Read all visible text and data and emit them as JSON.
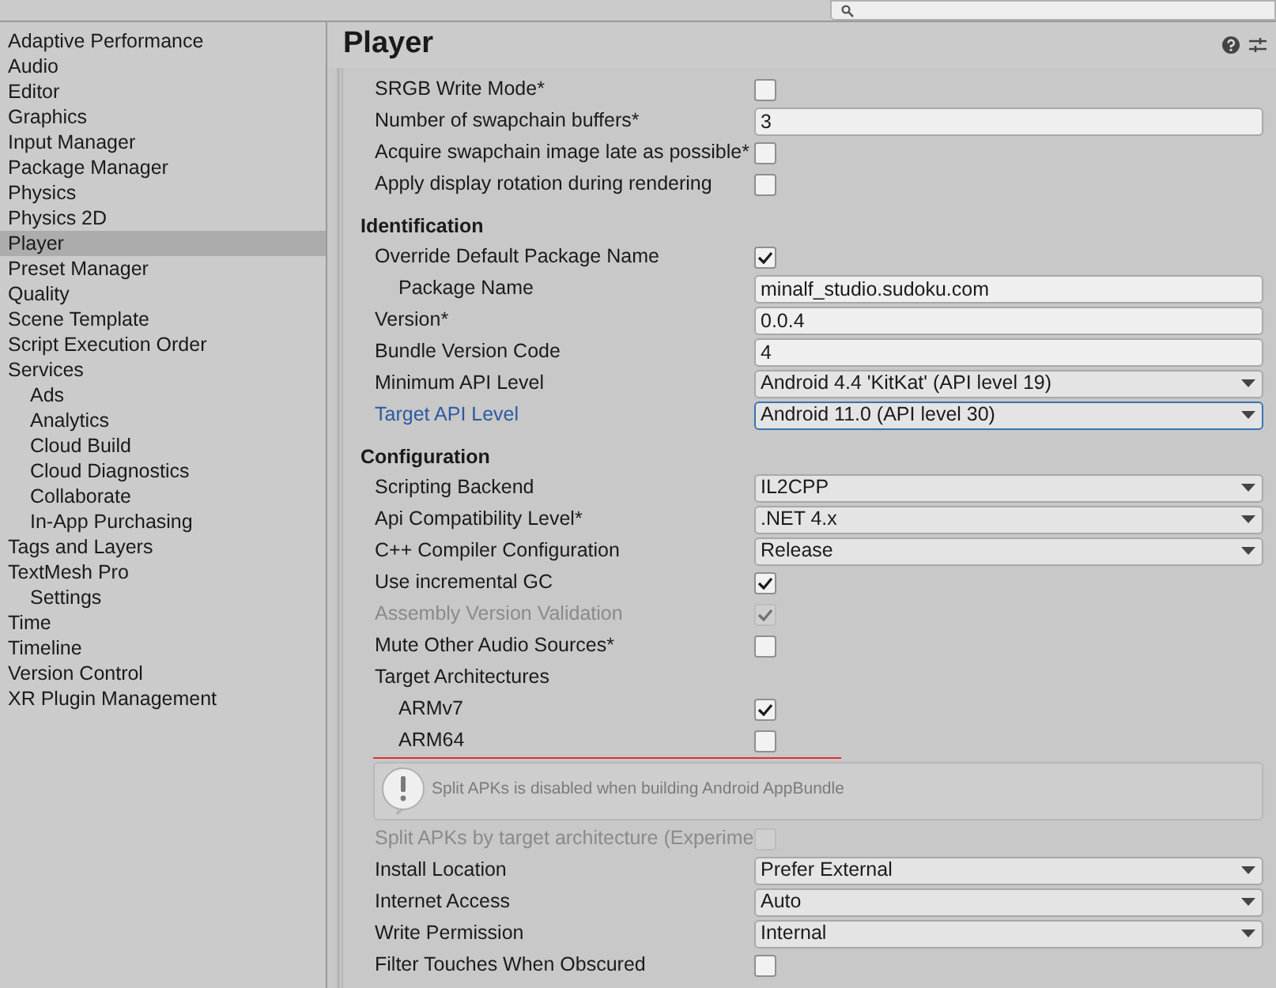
{
  "sidebar": {
    "items": [
      {
        "label": "Adaptive Performance",
        "selected": false
      },
      {
        "label": "Audio",
        "selected": false
      },
      {
        "label": "Editor",
        "selected": false
      },
      {
        "label": "Graphics",
        "selected": false
      },
      {
        "label": "Input Manager",
        "selected": false
      },
      {
        "label": "Package Manager",
        "selected": false
      },
      {
        "label": "Physics",
        "selected": false
      },
      {
        "label": "Physics 2D",
        "selected": false
      },
      {
        "label": "Player",
        "selected": true
      },
      {
        "label": "Preset Manager",
        "selected": false
      },
      {
        "label": "Quality",
        "selected": false
      },
      {
        "label": "Scene Template",
        "selected": false
      },
      {
        "label": "Script Execution Order",
        "selected": false
      },
      {
        "label": "Services",
        "selected": false,
        "children": [
          {
            "label": "Ads",
            "selected": false
          },
          {
            "label": "Analytics",
            "selected": false
          },
          {
            "label": "Cloud Build",
            "selected": false
          },
          {
            "label": "Cloud Diagnostics",
            "selected": false
          },
          {
            "label": "Collaborate",
            "selected": false
          },
          {
            "label": "In-App Purchasing",
            "selected": false
          }
        ]
      },
      {
        "label": "Tags and Layers",
        "selected": false
      },
      {
        "label": "TextMesh Pro",
        "selected": false,
        "children": [
          {
            "label": "Settings",
            "selected": false
          }
        ]
      },
      {
        "label": "Time",
        "selected": false
      },
      {
        "label": "Timeline",
        "selected": false
      },
      {
        "label": "Version Control",
        "selected": false
      },
      {
        "label": "XR Plugin Management",
        "selected": false
      }
    ]
  },
  "header": {
    "title": "Player"
  },
  "sections": [
    {
      "rows": [
        {
          "kind": "checkbox",
          "label": "SRGB Write Mode*",
          "checked": false,
          "disabled": false
        },
        {
          "kind": "text",
          "label": "Number of swapchain buffers*",
          "value": "3"
        },
        {
          "kind": "checkbox",
          "label": "Acquire swapchain image late as possible*",
          "checked": false,
          "disabled": false
        },
        {
          "kind": "checkbox",
          "label": "Apply display rotation during rendering",
          "checked": false,
          "disabled": false
        }
      ]
    },
    {
      "title": "Identification",
      "rows": [
        {
          "kind": "checkbox",
          "label": "Override Default Package Name",
          "checked": true,
          "disabled": false,
          "children": [
            {
              "kind": "text",
              "label": "Package Name",
              "value": "minalf_studio.sudoku.com"
            }
          ]
        },
        {
          "kind": "text",
          "label": "Version*",
          "value": "0.0.4"
        },
        {
          "kind": "text",
          "label": "Bundle Version Code",
          "value": "4"
        },
        {
          "kind": "dropdown",
          "label": "Minimum API Level",
          "value": "Android 4.4 'KitKat' (API level 19)",
          "focused": false
        },
        {
          "kind": "dropdown",
          "label": "Target API Level",
          "value": "Android 11.0 (API level 30)",
          "focused": true
        }
      ]
    },
    {
      "title": "Configuration",
      "rows": [
        {
          "kind": "dropdown",
          "label": "Scripting Backend",
          "value": "IL2CPP",
          "focused": false
        },
        {
          "kind": "dropdown",
          "label": "Api Compatibility Level*",
          "value": ".NET 4.x",
          "focused": false
        },
        {
          "kind": "dropdown",
          "label": "C++ Compiler Configuration",
          "value": "Release",
          "focused": false
        },
        {
          "kind": "checkbox",
          "label": "Use incremental GC",
          "checked": true,
          "disabled": false
        },
        {
          "kind": "checkbox",
          "label": "Assembly Version Validation",
          "checked": true,
          "disabled": true
        },
        {
          "kind": "checkbox",
          "label": "Mute Other Audio Sources*",
          "checked": false,
          "disabled": false
        },
        {
          "kind": "label",
          "label": "Target Architectures",
          "children": [
            {
              "kind": "checkbox",
              "label": "ARMv7",
              "checked": true,
              "disabled": false
            },
            {
              "kind": "checkbox",
              "label": "ARM64",
              "checked": false,
              "disabled": false
            }
          ]
        },
        {
          "kind": "help",
          "message": "Split APKs is disabled when building Android AppBundle"
        },
        {
          "kind": "checkbox",
          "label": "Split APKs by target architecture (Experime",
          "checked": false,
          "disabled": true
        },
        {
          "kind": "dropdown",
          "label": "Install Location",
          "value": "Prefer External",
          "focused": false
        },
        {
          "kind": "dropdown",
          "label": "Internet Access",
          "value": "Auto",
          "focused": false
        },
        {
          "kind": "dropdown",
          "label": "Write Permission",
          "value": "Internal",
          "focused": false
        },
        {
          "kind": "checkbox",
          "label": "Filter Touches When Obscured",
          "checked": false,
          "disabled": false
        }
      ]
    }
  ]
}
